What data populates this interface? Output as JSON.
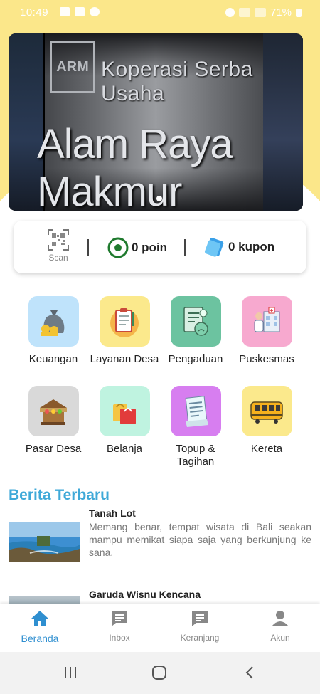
{
  "status_bar": {
    "time": "10:49",
    "battery": "71%"
  },
  "banner": {
    "logo_text": "ARM",
    "line1": "Koperasi Serba Usaha",
    "line2": "Alam Raya Makmur"
  },
  "points_card": {
    "scan_label": "Scan",
    "points_text": "0 poin",
    "coupon_text": "0 kupon"
  },
  "menu": [
    {
      "label": "Keuangan",
      "icon": "money-bag-icon",
      "color": "#bfe3fb"
    },
    {
      "label": "Layanan Desa",
      "icon": "clipboard-icon",
      "color": "#fbe98c"
    },
    {
      "label": "Pengaduan",
      "icon": "complaint-document-icon",
      "color": "#6cc3a0"
    },
    {
      "label": "Puskesmas",
      "icon": "health-center-icon",
      "color": "#f7a9cf"
    },
    {
      "label": "Pasar Desa",
      "icon": "market-stall-icon",
      "color": "#d9d9d9"
    },
    {
      "label": "Belanja",
      "icon": "shopping-bags-icon",
      "color": "#bff3e0"
    },
    {
      "label": "Topup & Tagihan",
      "icon": "receipt-icon",
      "color": "#d77ef0"
    },
    {
      "label": "Kereta",
      "icon": "train-icon",
      "color": "#fbe98c"
    }
  ],
  "news": {
    "section_title": "Berita Terbaru",
    "items": [
      {
        "title": "Tanah Lot",
        "body": "Memang benar, tempat wisata di Bali seakan mampu memikat siapa saja yang berkunjung ke sana."
      },
      {
        "title": "Garuda Wisnu Kencana",
        "body": ""
      }
    ]
  },
  "bottom_nav": [
    {
      "label": "Beranda",
      "icon": "home-icon",
      "active": true
    },
    {
      "label": "Inbox",
      "icon": "chat-icon",
      "active": false
    },
    {
      "label": "Keranjang",
      "icon": "cart-message-icon",
      "active": false
    },
    {
      "label": "Akun",
      "icon": "person-icon",
      "active": false
    }
  ],
  "colors": {
    "accent": "#2f8fd0",
    "header_yellow": "#fbe78a",
    "news_title": "#3fa9d8",
    "points_green": "#1f7a2e"
  }
}
